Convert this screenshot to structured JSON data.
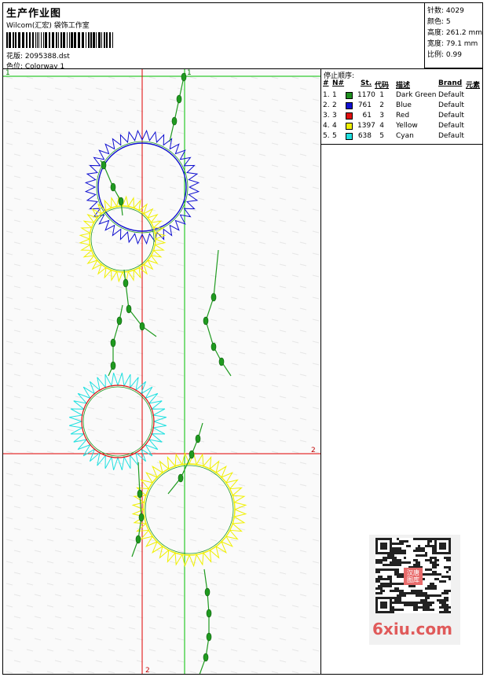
{
  "header": {
    "title": "生产作业图",
    "company": "Wilcom(汇宏) 袋饰工作室",
    "design_label": "花版: 2095388.dst",
    "colorway_label": "色位: Colorway 1"
  },
  "stats": {
    "stitches": "针数: 4029",
    "colors": "颜色: 5",
    "height": "高度: 261.2 mm",
    "width": "宽度: 79.1 mm",
    "scale": "比例: 0.99"
  },
  "stop_sequence": {
    "title": "停止顺序:",
    "headers": [
      "#",
      "N#",
      "St.",
      "代码",
      "描述",
      "Brand",
      "元素"
    ],
    "rows": [
      {
        "idx": "1.",
        "n": "1",
        "color": "#1f8f1f",
        "st": "1170",
        "code": "1",
        "desc": "Dark Green",
        "brand": "Default"
      },
      {
        "idx": "2.",
        "n": "2",
        "color": "#1010d0",
        "st": "761",
        "code": "2",
        "desc": "Blue",
        "brand": "Default"
      },
      {
        "idx": "3.",
        "n": "3",
        "color": "#e01010",
        "st": "61",
        "code": "3",
        "desc": "Red",
        "brand": "Default"
      },
      {
        "idx": "4.",
        "n": "4",
        "color": "#f0f000",
        "st": "1397",
        "code": "4",
        "desc": "Yellow",
        "brand": "Default"
      },
      {
        "idx": "5.",
        "n": "5",
        "color": "#20e0e0",
        "st": "638",
        "code": "5",
        "desc": "Cyan",
        "brand": "Default"
      }
    ]
  },
  "canvas": {
    "axis_labels": {
      "green_top_1": "1",
      "green_left_1": "1",
      "red_right_2": "2",
      "red_bottom_2": "2"
    }
  },
  "watermark": {
    "qr_stamp": "汉唐\n图库",
    "site": "6xiu.com"
  },
  "colors": {
    "green": "#1f9a1f",
    "blue": "#1010d0",
    "red": "#e01010",
    "yellow": "#f0f000",
    "cyan": "#20e0e0",
    "guide_red": "#e00000",
    "guide_green": "#00c000"
  }
}
